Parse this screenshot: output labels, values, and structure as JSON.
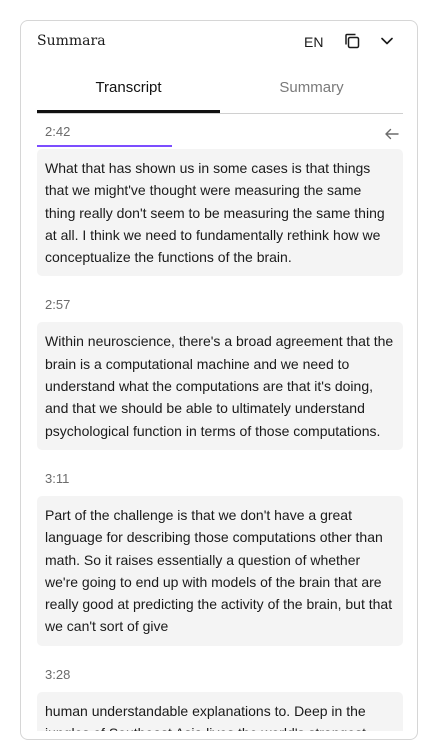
{
  "header": {
    "brand": "Summara",
    "language": "EN"
  },
  "tabs": [
    {
      "label": "Transcript",
      "active": true
    },
    {
      "label": "Summary",
      "active": false
    }
  ],
  "colors": {
    "accent": "#7c4dff",
    "card_background": "#f4f4f4"
  },
  "playback": {
    "progress_fraction": 0.37
  },
  "segments": [
    {
      "time": "2:42",
      "text": "What that has shown us in some cases is that things that we might've thought were measuring the same thing really don't seem to be measuring the same thing at all. I think we need to fundamentally rethink how we conceptualize the functions of the brain."
    },
    {
      "time": "2:57",
      "text": "Within neuroscience, there's a broad agreement that the brain is a computational machine and we need to understand what the computations are that it's doing, and that we should be able to ultimately understand psychological function in terms of those computations."
    },
    {
      "time": "3:11",
      "text": "Part of the challenge is that we don't have a great language for describing those computations other than math. So it raises essentially a question of whether we're going to end up with models of the brain that are really good at predicting the activity of the brain, but that we can't sort of give"
    },
    {
      "time": "3:28",
      "text": "human understandable explanations to. Deep in the jungles of Southeast Asia lives the world's strangest"
    }
  ]
}
